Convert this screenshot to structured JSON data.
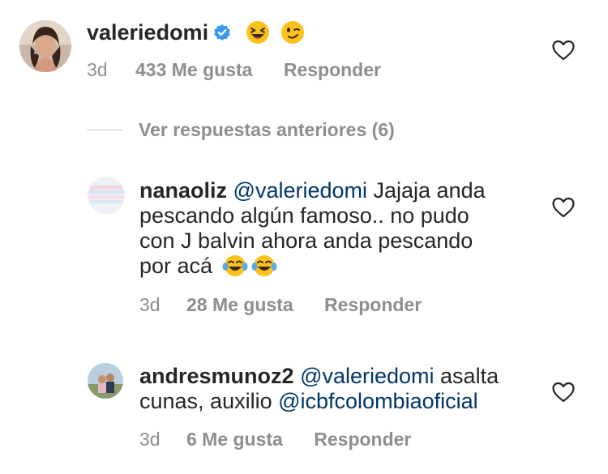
{
  "comments": [
    {
      "username": "valeriedomi",
      "verified": true,
      "text_mention": "",
      "text": "",
      "emojis": [
        "grinning-squinting",
        "winking"
      ],
      "time": "3d",
      "likes": "433 Me gusta",
      "reply": "Responder"
    },
    {
      "username": "nanaoliz",
      "mention": "@valeriedomi",
      "text_line1_rest": " Jajaja anda",
      "text_line2": "pescando algún famoso.. no pudo",
      "text_line3": "con J balvin ahora anda pescando",
      "text_line4": "por acá",
      "emojis": [
        "tears-of-joy",
        "tears-of-joy"
      ],
      "time": "3d",
      "likes": "28 Me gusta",
      "reply": "Responder"
    },
    {
      "username": "andresmunoz2",
      "mention": "@valeriedomi",
      "text_line1_rest": " asalta",
      "text_line2_prefix": "cunas, auxilio ",
      "mention2": "@icbfcolombiaoficial",
      "time": "3d",
      "likes": "6 Me gusta",
      "reply": "Responder"
    }
  ],
  "view_replies": "Ver respuestas anteriores (6)",
  "icons": {
    "like": "heart-outline-icon",
    "verified": "verified-badge-icon"
  },
  "colors": {
    "mention": "#00376b",
    "muted": "#8e8e8e",
    "verified": "#3897f0"
  }
}
